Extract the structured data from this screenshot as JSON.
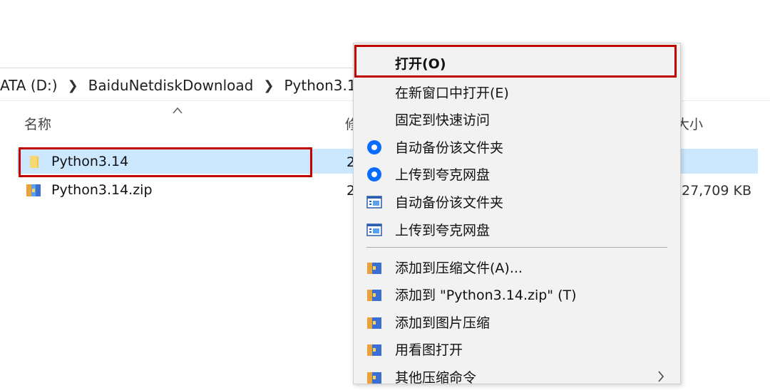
{
  "explorer": {
    "breadcrumb": [
      "ATA (D:)",
      "BaiduNetdiskDownload",
      "Python3.1"
    ],
    "columns": {
      "name": "名称",
      "date": "修",
      "size": "大小"
    },
    "files": [
      {
        "name": "Python3.14",
        "date": "2",
        "size": "",
        "icon": "folder-icon",
        "selected": true
      },
      {
        "name": "Python3.14.zip",
        "date": "2",
        "size": "27,709 KB",
        "icon": "zip-archive-icon",
        "selected": false
      }
    ]
  },
  "context_menu": {
    "items": [
      {
        "label": "打开(O)",
        "icon": "",
        "bold": true
      },
      {
        "label": "在新窗口中打开(E)",
        "icon": ""
      },
      {
        "label": "固定到快速访问",
        "icon": ""
      },
      {
        "label": "自动备份该文件夹",
        "icon": "quark-circle-icon"
      },
      {
        "label": "上传到夸克网盘",
        "icon": "quark-circle-icon"
      },
      {
        "label": "自动备份该文件夹",
        "icon": "window-app-icon"
      },
      {
        "label": "上传到夸克网盘",
        "icon": "window-app-icon"
      },
      {
        "label": "添加到压缩文件(A)...",
        "icon": "archive-icon"
      },
      {
        "label": "添加到 \"Python3.14.zip\" (T)",
        "icon": "archive-icon"
      },
      {
        "label": "添加到图片压缩",
        "icon": "archive-icon"
      },
      {
        "label": "用看图打开",
        "icon": "archive-icon"
      },
      {
        "label": "其他压缩命令",
        "icon": "archive-icon",
        "submenu": true
      }
    ]
  },
  "colors": {
    "selection": "#cce8ff",
    "highlight_border": "#c00000",
    "accent_blue": "#0a6cff",
    "menu_bg": "#f2f2f2"
  }
}
